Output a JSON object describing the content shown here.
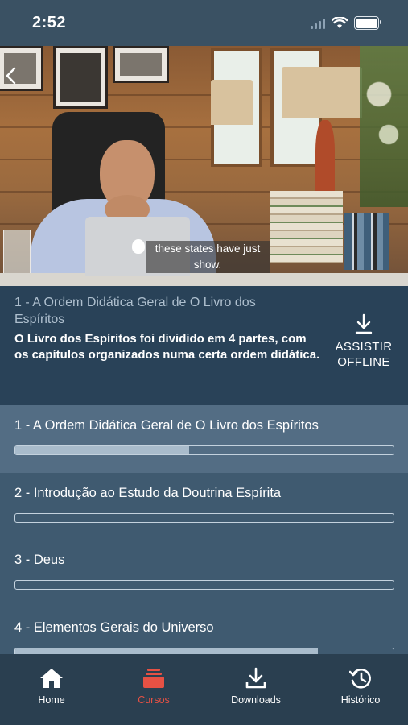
{
  "status_bar": {
    "time": "2:52"
  },
  "video": {
    "subtitle": "these states have just show."
  },
  "lesson": {
    "title": "1 - A Ordem Didática Geral de O Livro dos Espíritos",
    "description": "O Livro dos Espíritos foi dividido em 4 partes, com os capítulos organizados numa certa ordem didática.",
    "offline_button": "ASSISTIR OFFLINE"
  },
  "lessons": [
    {
      "label": "1 - A Ordem Didática Geral de O Livro dos Espíritos",
      "progress": 0.46,
      "active": true
    },
    {
      "label": "2 - Introdução ao Estudo da Doutrina Espírita",
      "progress": 0.0,
      "active": false
    },
    {
      "label": "3 - Deus",
      "progress": 0.0,
      "active": false
    },
    {
      "label": "4 - Elementos Gerais do Universo",
      "progress": 0.8,
      "active": false
    }
  ],
  "tabs": [
    {
      "label": "Home",
      "icon": "home-icon",
      "active": false
    },
    {
      "label": "Cursos",
      "icon": "courses-icon",
      "active": true
    },
    {
      "label": "Downloads",
      "icon": "download-icon",
      "active": false
    },
    {
      "label": "Histórico",
      "icon": "history-icon",
      "active": false
    }
  ],
  "colors": {
    "accent": "#e65144",
    "panel": "#294258",
    "active_row": "#536d84",
    "tabbar": "#2a3f50"
  }
}
